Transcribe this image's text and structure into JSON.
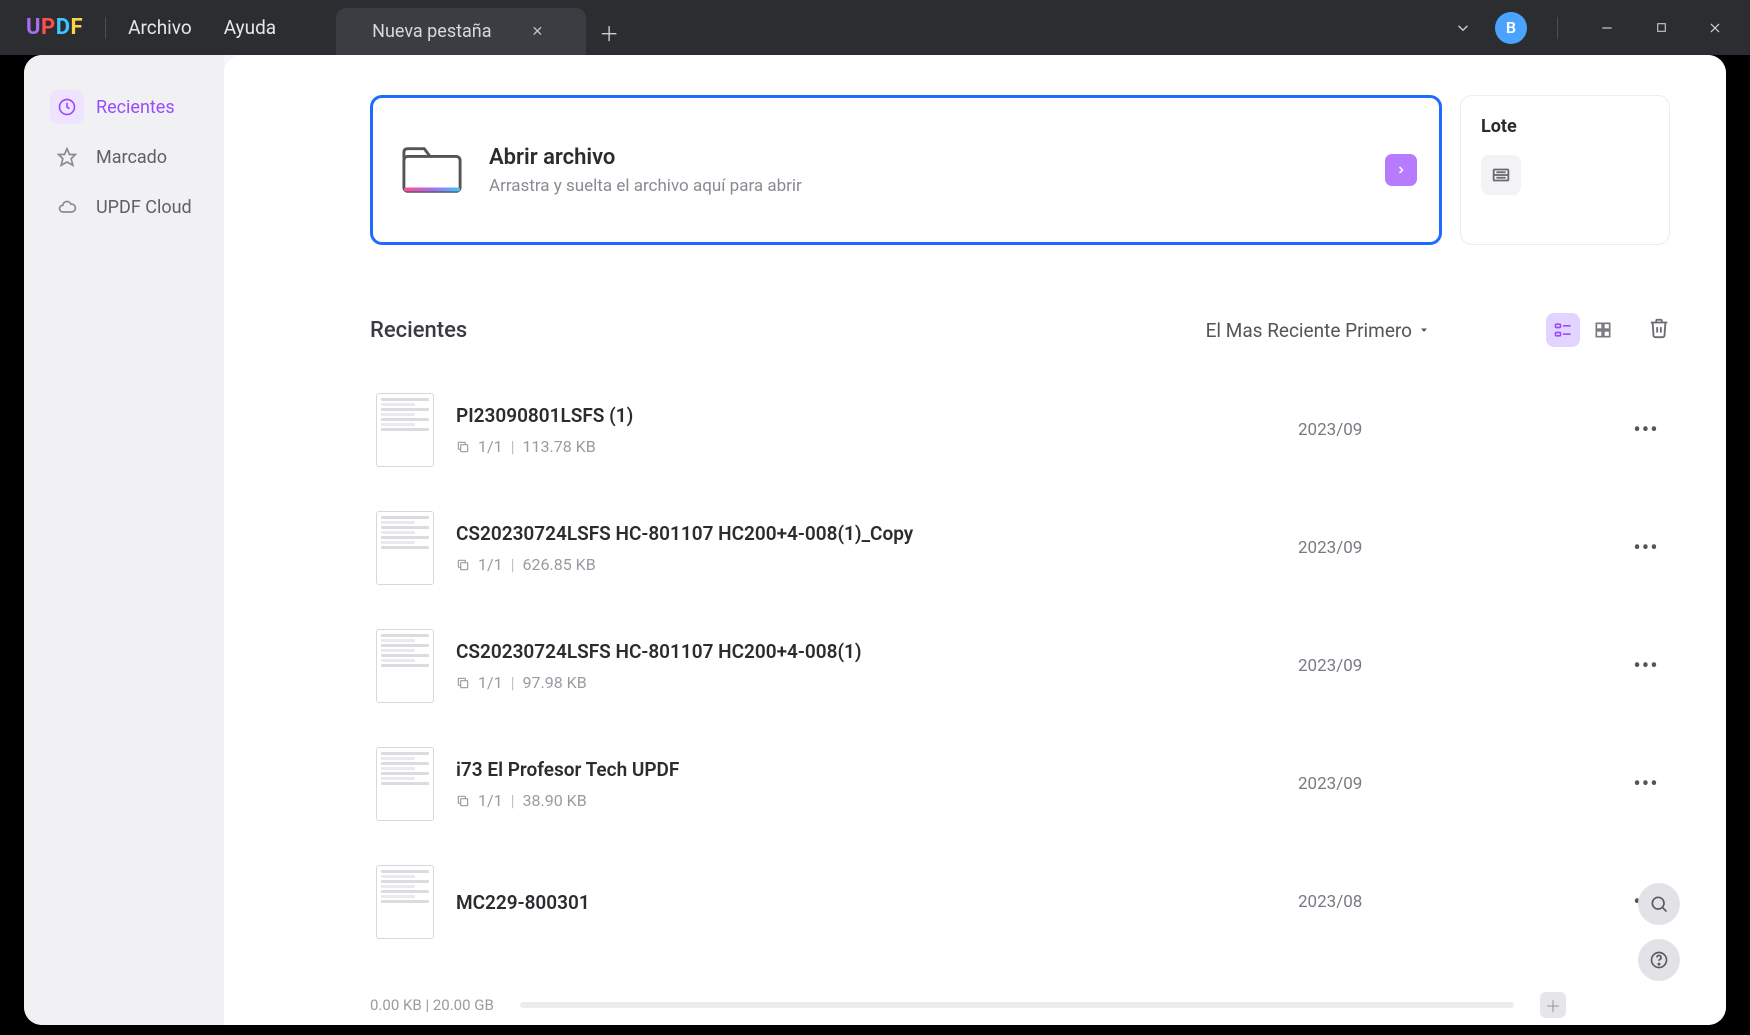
{
  "title_bar": {
    "logo": "UPDF",
    "menu": {
      "file": "Archivo",
      "help": "Ayuda"
    },
    "tab_label": "Nueva pestaña",
    "avatar_letter": "B"
  },
  "sidebar": {
    "recents": "Recientes",
    "marked": "Marcado",
    "cloud": "UPDF Cloud"
  },
  "open_file": {
    "title": "Abrir archivo",
    "subtitle": "Arrastra y suelta el archivo aquí para abrir"
  },
  "batch": {
    "title": "Lote"
  },
  "recents_panel": {
    "title": "Recientes",
    "sort_label": "El Mas Reciente Primero"
  },
  "files": [
    {
      "name": "PI23090801LSFS (1)",
      "pages": "1/1",
      "size": "113.78 KB",
      "date": "2023/09"
    },
    {
      "name": "CS20230724LSFS      HC-801107   HC200+4-008(1)_Copy",
      "pages": "1/1",
      "size": "626.85 KB",
      "date": "2023/09"
    },
    {
      "name": "CS20230724LSFS      HC-801107   HC200+4-008(1)",
      "pages": "1/1",
      "size": "97.98 KB",
      "date": "2023/09"
    },
    {
      "name": "i73 El Profesor Tech UPDF",
      "pages": "1/1",
      "size": "38.90 KB",
      "date": "2023/09"
    },
    {
      "name": "MC229-800301",
      "pages": "",
      "size": "",
      "date": "2023/08"
    }
  ],
  "storage": {
    "label": "0.00 KB | 20.00 GB"
  }
}
